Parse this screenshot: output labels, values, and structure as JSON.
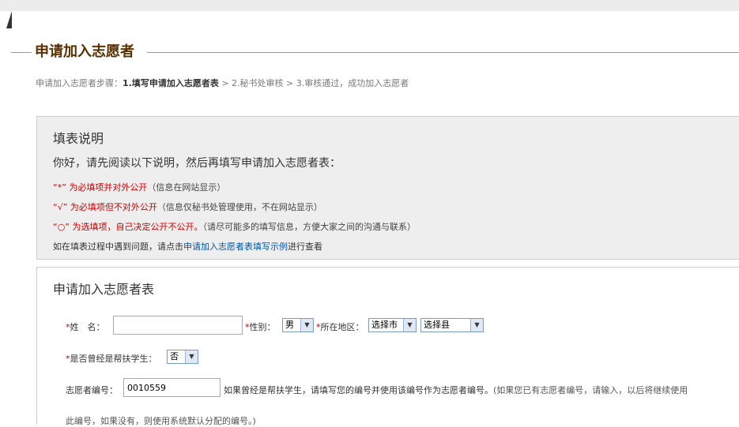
{
  "page_title": "申请加入志愿者",
  "steps": {
    "prefix": "申请加入志愿者步骤：",
    "step1": "1.填写申请加入志愿者表",
    "step2": " > 2.秘书处审核 > 3.审核通过，成功加入志愿者"
  },
  "notes": {
    "title": "填表说明",
    "greeting": "你好，请先阅读以下说明，然后再填写申请加入志愿者表：",
    "items": [
      {
        "mark": "“*” 为必填项并对外公开",
        "desc": "（信息在网站显示）"
      },
      {
        "mark": "“√” 为必填项但不对外公开",
        "desc": "（信息仅秘书处管理使用，不在网站显示）"
      },
      {
        "mark": "“○” 为选填项，自己决定公开不公开。",
        "desc": "（请尽可能多的填写信息，方便大家之间的沟通与联系）"
      }
    ],
    "help_prefix": "如在填表过程中遇到问题，请点击",
    "help_link": "申请加入志愿者表填写示例",
    "help_suffix": "进行查看"
  },
  "form": {
    "title": "申请加入志愿者表",
    "name_label": "姓　名：",
    "name_value": "",
    "gender_label": "性别：",
    "gender_value": "男",
    "region_label": "所在地区：",
    "city_value": "选择市",
    "county_value": "选择县",
    "aided_label": "是否曾经是帮扶学生：",
    "aided_value": "否",
    "id_label": "志愿者编号：",
    "id_value": "0010559",
    "id_hint_bold": "如果曾经是帮扶学生，请填写您的编号并使用该编号作为志愿者编号。",
    "id_hint": "(如果您已有志愿者编号，请输入，以后将继续使用",
    "cut_line": "此编号，如果没有，则使用系统默认分配的编号。)"
  },
  "colors": {
    "title": "#5a3000",
    "required": "#cc0000",
    "link": "#0055aa",
    "notes_bg": "#eeeeee"
  }
}
